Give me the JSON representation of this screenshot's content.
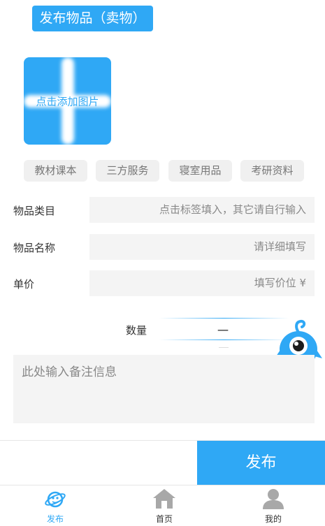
{
  "header": {
    "title": "发布物品（卖物）"
  },
  "upload": {
    "label": "点击添加图片"
  },
  "tags": [
    "教材课本",
    "三方服务",
    "寝室用品",
    "考研资料"
  ],
  "form": {
    "category": {
      "label": "物品类目",
      "placeholder": "点击标签填入，其它请自行输入"
    },
    "name": {
      "label": "物品名称",
      "placeholder": "请详细填写"
    },
    "price": {
      "label": "单价",
      "placeholder": "填写价位 ¥"
    },
    "quantity": {
      "label": "数量",
      "minus": "一"
    },
    "remarks": {
      "placeholder": "此处输入备注信息"
    }
  },
  "actions": {
    "publish": "发布"
  },
  "tabbar": {
    "items": [
      {
        "label": "发布",
        "icon": "planet-icon",
        "active": true
      },
      {
        "label": "首页",
        "icon": "home-icon",
        "active": false
      },
      {
        "label": "我的",
        "icon": "user-icon",
        "active": false
      }
    ]
  },
  "colors": {
    "accent": "#2fa8f5",
    "input_bg": "#f4f4f4",
    "tag_bg": "#f0f0f0"
  }
}
